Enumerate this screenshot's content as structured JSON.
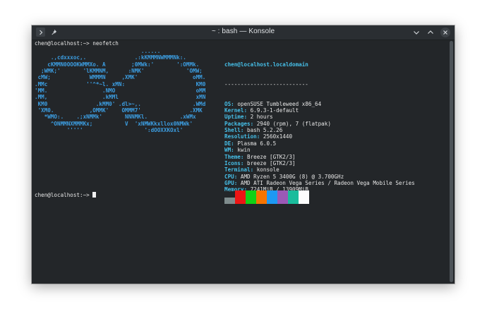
{
  "window": {
    "title": "~ : bash — Konsole"
  },
  "terminal": {
    "command_line": "chen@localhost:~> neofetch",
    "final_prompt": "chen@localhost:~> ",
    "logo_lines": [
      "                                 ......",
      "     .,cdxxxoc,.               .:kKMMMNWMMMNk:.",
      "    cKMMN0OOOKWMMXo. A        ;0MWk:'       ':OMMk.",
      "  ;WMK;'       'lKMMNM,      :NMK'             'OMW;",
      " cMW;            WMMMN     ,XMK'                 oMM.",
      ".MMc            ''^*~l. xMN:                      KM0",
      "'MM.                 .NMO                         oMM",
      ".MM,                 .kMMl                        xMN",
      " KM0               .kMM0' .dl>~,.                .WMd",
      " 'XM0.           ,OMMK'    OMMM7'               .XMK",
      "   *WMO:.    .;xNMMk'       NNNMKl.          .xWMx",
      "     ^ONMMNXMMMKx;          V  'xNMWKkxllox0NMWk'",
      "          '''''                   ':dOOXXKOxl'"
    ],
    "user_host": "chen@localhost.localdomain",
    "separator": "--------------------------",
    "info": [
      {
        "key": "OS",
        "value": "openSUSE Tumbleweed x86_64"
      },
      {
        "key": "Kernel",
        "value": "6.9.3-1-default"
      },
      {
        "key": "Uptime",
        "value": "2 hours"
      },
      {
        "key": "Packages",
        "value": "2940 (rpm), 7 (flatpak)"
      },
      {
        "key": "Shell",
        "value": "bash 5.2.26"
      },
      {
        "key": "Resolution",
        "value": "2560x1440"
      },
      {
        "key": "DE",
        "value": "Plasma 6.0.5"
      },
      {
        "key": "WM",
        "value": "kwin"
      },
      {
        "key": "Theme",
        "value": "Breeze [GTK2/3]"
      },
      {
        "key": "Icons",
        "value": "breeze [GTK2/3]"
      },
      {
        "key": "Terminal",
        "value": "konsole"
      },
      {
        "key": "CPU",
        "value": "AMD Ryzen 5 3400G (8) @ 3.700GHz"
      },
      {
        "key": "GPU",
        "value": "AMD ATI Radeon Vega Series / Radeon Vega Mobile Series"
      },
      {
        "key": "Memory",
        "value": "7241MiB / 13909MiB"
      }
    ],
    "palette": [
      {
        "color": "#7f8c8d",
        "half": true
      },
      {
        "color": "#ed1515",
        "half": false
      },
      {
        "color": "#11d116",
        "half": false
      },
      {
        "color": "#f67400",
        "half": false
      },
      {
        "color": "#1d99f3",
        "half": false
      },
      {
        "color": "#9b59b6",
        "half": false
      },
      {
        "color": "#1abc9c",
        "half": false
      },
      {
        "color": "#fcfcfc",
        "half": false
      }
    ]
  },
  "icons": {
    "menu": "chevron-right-icon",
    "pin": "pin-icon",
    "minimize": "chevron-down-icon",
    "maximize": "chevron-up-icon",
    "close": "close-icon"
  }
}
